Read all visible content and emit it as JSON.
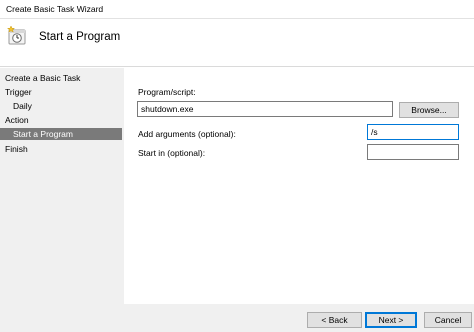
{
  "window": {
    "title": "Create Basic Task Wizard"
  },
  "header": {
    "heading": "Start a Program",
    "icon": "task-scheduler-clock-icon"
  },
  "sidebar": {
    "items": [
      {
        "label": "Create a Basic Task"
      },
      {
        "label": "Trigger"
      },
      {
        "label": "Daily"
      },
      {
        "label": "Action"
      },
      {
        "label": "Start a Program"
      },
      {
        "label": "Finish"
      }
    ],
    "selected": "Start a Program"
  },
  "form": {
    "program_label": "Program/script:",
    "program_value": "shutdown.exe",
    "browse_label": "Browse...",
    "args_label": "Add arguments (optional):",
    "args_value": "/s",
    "startin_label": "Start in (optional):",
    "startin_value": ""
  },
  "footer": {
    "back_label": "< Back",
    "next_label": "Next >",
    "cancel_label": "Cancel"
  },
  "colors": {
    "accent": "#0078d7",
    "selected_bg": "#7a7a7a",
    "panel_bg": "#f0f0f0"
  }
}
